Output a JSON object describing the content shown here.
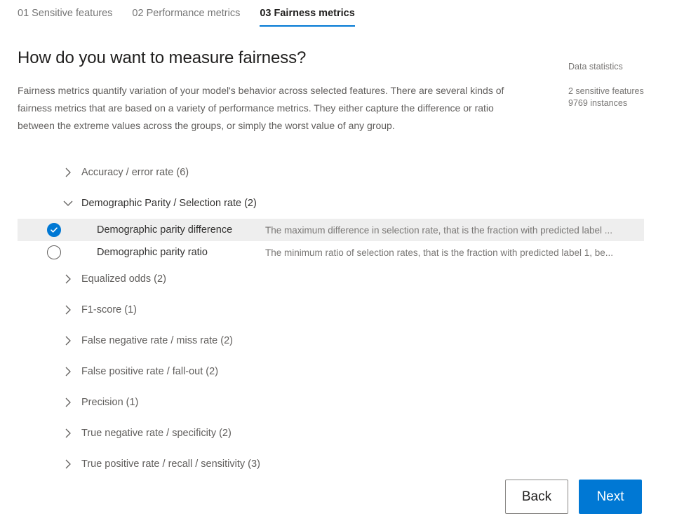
{
  "tabs": [
    {
      "label": "01 Sensitive features",
      "active": false
    },
    {
      "label": "02 Performance metrics",
      "active": false
    },
    {
      "label": "03 Fairness metrics",
      "active": true
    }
  ],
  "header": {
    "title": "How do you want to measure fairness?",
    "description": "Fairness metrics quantify variation of your model's behavior across selected features. There are several kinds of fairness metrics that are based on a variety of performance metrics. They either capture the difference or ratio between the extreme values across the groups, or simply the worst value of any group."
  },
  "stats": {
    "title": "Data statistics",
    "sensitive_features": "2 sensitive features",
    "instances": "9769 instances"
  },
  "metrics": [
    {
      "label": "Accuracy / error rate (6)",
      "expanded": false,
      "options": []
    },
    {
      "label": "Demographic Parity / Selection rate (2)",
      "expanded": true,
      "options": [
        {
          "label": "Demographic parity difference",
          "description": "The maximum difference in selection rate, that is the fraction with predicted label ...",
          "selected": true
        },
        {
          "label": "Demographic parity ratio",
          "description": "The minimum ratio of selection rates, that is the fraction with predicted label 1, be...",
          "selected": false
        }
      ]
    },
    {
      "label": "Equalized odds (2)",
      "expanded": false,
      "options": []
    },
    {
      "label": "F1-score (1)",
      "expanded": false,
      "options": []
    },
    {
      "label": "False negative rate / miss rate (2)",
      "expanded": false,
      "options": []
    },
    {
      "label": "False positive rate / fall-out (2)",
      "expanded": false,
      "options": []
    },
    {
      "label": "Precision (1)",
      "expanded": false,
      "options": []
    },
    {
      "label": "True negative rate / specificity (2)",
      "expanded": false,
      "options": []
    },
    {
      "label": "True positive rate / recall / sensitivity (3)",
      "expanded": false,
      "options": []
    }
  ],
  "footer": {
    "back_label": "Back",
    "next_label": "Next"
  },
  "colors": {
    "accent": "#0078d4",
    "selected_row_bg": "#eeeeee",
    "muted_text": "#605e5c"
  }
}
